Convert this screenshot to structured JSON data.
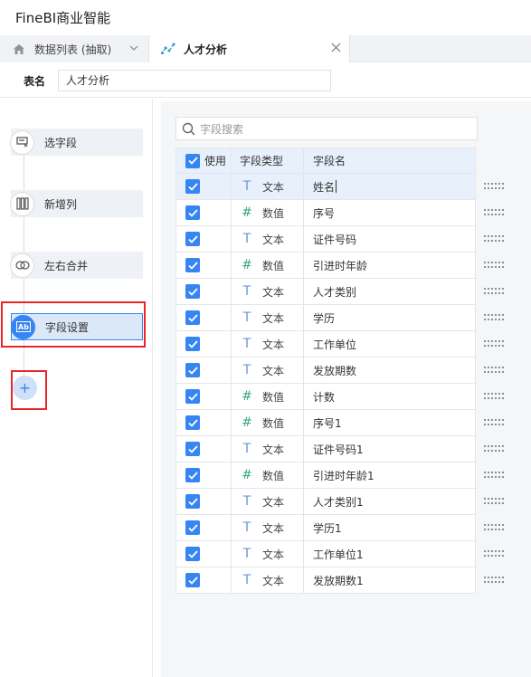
{
  "app": {
    "title": "FineBI商业智能"
  },
  "tabs": [
    {
      "label": "数据列表 (抽取)",
      "icon": "home-icon",
      "active": false
    },
    {
      "label": "人才分析",
      "icon": "analysis-icon",
      "active": true
    }
  ],
  "table_name": {
    "label": "表名",
    "value": "人才分析"
  },
  "steps": [
    {
      "label": "选字段",
      "icon": "select-field-icon"
    },
    {
      "label": "新增列",
      "icon": "add-column-icon"
    },
    {
      "label": "左右合并",
      "icon": "merge-icon"
    },
    {
      "label": "字段设置",
      "icon": "field-settings-icon",
      "active": true
    }
  ],
  "add_step": {
    "label": "+"
  },
  "search": {
    "placeholder": "字段搜索"
  },
  "columns": {
    "use": "使用",
    "type": "字段类型",
    "name": "字段名"
  },
  "rows": [
    {
      "type": "文本",
      "type_icon": "T",
      "name": "姓名",
      "checked": true,
      "editing": true
    },
    {
      "type": "数值",
      "type_icon": "#",
      "name": "序号",
      "checked": true
    },
    {
      "type": "文本",
      "type_icon": "T",
      "name": "证件号码",
      "checked": true
    },
    {
      "type": "数值",
      "type_icon": "#",
      "name": "引进时年龄",
      "checked": true
    },
    {
      "type": "文本",
      "type_icon": "T",
      "name": "人才类别",
      "checked": true
    },
    {
      "type": "文本",
      "type_icon": "T",
      "name": "学历",
      "checked": true
    },
    {
      "type": "文本",
      "type_icon": "T",
      "name": "工作单位",
      "checked": true
    },
    {
      "type": "文本",
      "type_icon": "T",
      "name": "发放期数",
      "checked": true
    },
    {
      "type": "数值",
      "type_icon": "#",
      "name": "计数",
      "checked": true
    },
    {
      "type": "数值",
      "type_icon": "#",
      "name": "序号1",
      "checked": true
    },
    {
      "type": "文本",
      "type_icon": "T",
      "name": "证件号码1",
      "checked": true
    },
    {
      "type": "数值",
      "type_icon": "#",
      "name": "引进时年龄1",
      "checked": true
    },
    {
      "type": "文本",
      "type_icon": "T",
      "name": "人才类别1",
      "checked": true
    },
    {
      "type": "文本",
      "type_icon": "T",
      "name": "学历1",
      "checked": true
    },
    {
      "type": "文本",
      "type_icon": "T",
      "name": "工作单位1",
      "checked": true
    },
    {
      "type": "文本",
      "type_icon": "T",
      "name": "发放期数1",
      "checked": true
    }
  ],
  "colors": {
    "accent": "#3685f2",
    "highlight": "#e8262a",
    "text_type_icon": "#6b96d6",
    "number_type_icon": "#3aa88a"
  }
}
